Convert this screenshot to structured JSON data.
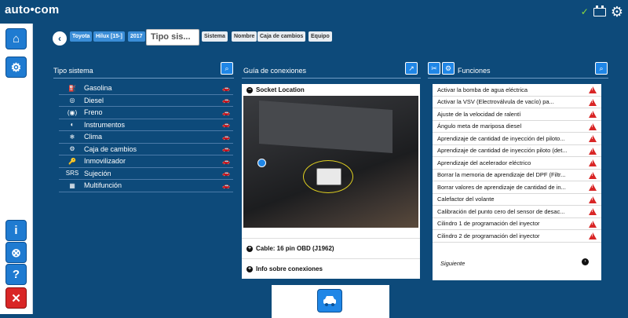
{
  "brand": {
    "logo": "auto•com"
  },
  "breadcrumb": {
    "back": "‹",
    "crumbs": [
      "Toyota",
      "Hilux [15-]",
      "2017"
    ],
    "input_placeholder": "Tipo sis...",
    "tabs": [
      "Sistema",
      "Nombre",
      "Caja de cambios",
      "Equipo"
    ]
  },
  "panels": {
    "tipo_sistema": {
      "title": "Tipo sistema",
      "items": [
        {
          "label": "Gasolina",
          "icon": "⛽"
        },
        {
          "label": "Diesel",
          "icon": "◎"
        },
        {
          "label": "Freno",
          "icon": "(◉)"
        },
        {
          "label": "Instrumentos",
          "icon": "◐"
        },
        {
          "label": "Clima",
          "icon": "❄"
        },
        {
          "label": "Caja de cambios",
          "icon": "⚙"
        },
        {
          "label": "Inmovilizador",
          "icon": "🔑"
        },
        {
          "label": "Sujeción",
          "icon": "SRS"
        },
        {
          "label": "Multifunción",
          "icon": "▦"
        }
      ]
    },
    "guia": {
      "title": "Guía de conexiones",
      "socket": "Socket Location",
      "cable": "Cable: 16 pin OBD (J1962)",
      "info": "Info sobre conexiones"
    },
    "funciones": {
      "title": "Funciones",
      "items": [
        "Activar la bomba de agua eléctrica",
        "Activar la VSV (Electroválvula de vacío) pa...",
        "Ajuste de la velocidad de ralentí",
        "Ángulo meta de mariposa diesel",
        "Aprendizaje de cantidad de inyección del piloto...",
        "Aprendizaje de cantidad de inyección piloto (det...",
        "Aprendizaje del acelerador eléctrico",
        "Borrar la memoria de aprendizaje del DPF (Filtr...",
        "Borrar valores de aprendizaje de cantidad de in...",
        "Calefactor del volante",
        "Calibración del punto cero del sensor de desac...",
        "Cilindro 1 de programación del inyector",
        "Cilindro 2 de programación del inyector"
      ],
      "next": "Siguiente"
    }
  }
}
